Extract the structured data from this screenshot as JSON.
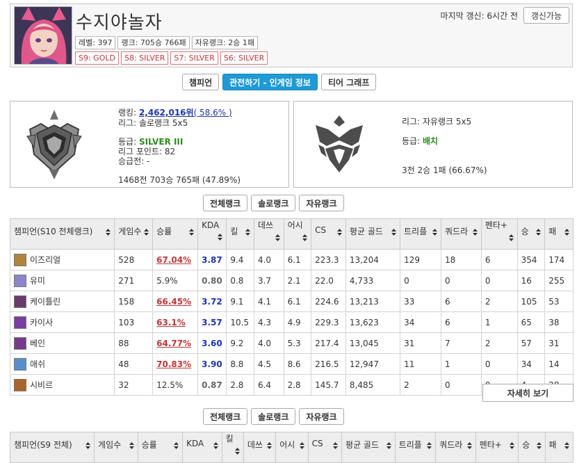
{
  "profile": {
    "summoner_name": "수지야놀자",
    "level": "레벨: 397",
    "ranking": "랭크: 705승 766패",
    "flex_rank": "자유랭크: 2승 1패",
    "seasons": [
      "S9: GOLD",
      "S8: SILVER",
      "S7: SILVER",
      "S6: SILVER"
    ],
    "last_update": "마지막 갱신: 6시간 전",
    "update_button": "갱신가능"
  },
  "main_tabs": [
    {
      "label": "챔피언",
      "active": false
    },
    {
      "label": "관전하기 - 인게임 정보",
      "active": true
    },
    {
      "label": "티어 그래프",
      "active": false
    }
  ],
  "solo_rank": {
    "ranking_label": "랭킹: ",
    "ranking_value": "2,462,016위",
    "ranking_pct": "( 58.6% )",
    "league": "리그: 솔로랭크 5x5",
    "tier_label": "등급: ",
    "tier_value": "SILVER III",
    "lp": "리그 포인트: 82",
    "promo": "승급전: -",
    "record": "1468전 703승 765패 (47.89%)"
  },
  "flex_rank": {
    "league": "리그: 자유랭크 5x5",
    "tier_label": "등급: ",
    "tier_value": "배치",
    "record": "3전 2승 1패 (66.67%)"
  },
  "sub_tabs": [
    "전체랭크",
    "솔로랭크",
    "자유랭크"
  ],
  "s10_table": {
    "headers": [
      "챔피언(S10 전체랭크)",
      "게임수",
      "승률",
      "KDA",
      "킬",
      "데쓰",
      "어시",
      "CS",
      "평균 골드",
      "트리플",
      "쿼드라",
      "펜타+",
      "승",
      "패"
    ],
    "rows": [
      {
        "champion": "이즈리얼",
        "icon_color": "#b0843c",
        "games": "528",
        "winrate": "67.04%",
        "winrate_hi": true,
        "kda": "3.87",
        "kda_hi": true,
        "kills": "9.4",
        "deaths": "4.0",
        "assists": "6.1",
        "cs": "223.3",
        "gold": "13,204",
        "triple": "129",
        "quadra": "18",
        "penta": "6",
        "wins": "354",
        "losses": "174"
      },
      {
        "champion": "유미",
        "icon_color": "#8d86c9",
        "games": "271",
        "winrate": "5.9%",
        "winrate_hi": false,
        "kda": "0.80",
        "kda_hi": false,
        "kills": "0.8",
        "deaths": "3.7",
        "assists": "2.1",
        "cs": "22.0",
        "gold": "4,733",
        "triple": "0",
        "quadra": "0",
        "penta": "0",
        "wins": "16",
        "losses": "255"
      },
      {
        "champion": "케이틀린",
        "icon_color": "#6b3a6a",
        "games": "158",
        "winrate": "66.45%",
        "winrate_hi": true,
        "kda": "3.72",
        "kda_hi": true,
        "kills": "9.1",
        "deaths": "4.1",
        "assists": "6.1",
        "cs": "224.6",
        "gold": "13,213",
        "triple": "33",
        "quadra": "6",
        "penta": "2",
        "wins": "105",
        "losses": "53"
      },
      {
        "champion": "카이사",
        "icon_color": "#7a3fa0",
        "games": "103",
        "winrate": "63.1%",
        "winrate_hi": true,
        "kda": "3.57",
        "kda_hi": true,
        "kills": "10.5",
        "deaths": "4.3",
        "assists": "4.9",
        "cs": "229.3",
        "gold": "13,623",
        "triple": "34",
        "quadra": "6",
        "penta": "1",
        "wins": "65",
        "losses": "38"
      },
      {
        "champion": "베인",
        "icon_color": "#7a3a8c",
        "games": "88",
        "winrate": "64.77%",
        "winrate_hi": true,
        "kda": "3.60",
        "kda_hi": true,
        "kills": "9.2",
        "deaths": "4.0",
        "assists": "5.3",
        "cs": "217.4",
        "gold": "13,045",
        "triple": "31",
        "quadra": "7",
        "penta": "2",
        "wins": "57",
        "losses": "31"
      },
      {
        "champion": "애쉬",
        "icon_color": "#5a8ec9",
        "games": "48",
        "winrate": "70.83%",
        "winrate_hi": true,
        "kda": "3.90",
        "kda_hi": true,
        "kills": "8.8",
        "deaths": "4.5",
        "assists": "8.6",
        "cs": "216.5",
        "gold": "12,947",
        "triple": "11",
        "quadra": "1",
        "penta": "0",
        "wins": "34",
        "losses": "14"
      },
      {
        "champion": "시비르",
        "icon_color": "#a8662a",
        "games": "32",
        "winrate": "12.5%",
        "winrate_hi": false,
        "kda": "0.87",
        "kda_hi": false,
        "kills": "2.8",
        "deaths": "6.4",
        "assists": "2.8",
        "cs": "145.7",
        "gold": "8,485",
        "triple": "2",
        "quadra": "0",
        "penta": "0",
        "wins": "4",
        "losses": "28"
      }
    ]
  },
  "more_button": "자세히 보기",
  "s9_table": {
    "headers": [
      "챔피언(S9 전체)",
      "게임수",
      "승률",
      "KDA",
      "킬",
      "데쓰",
      "어시",
      "CS",
      "평균 골드",
      "트리플",
      "쿼드라",
      "펜타+",
      "승",
      "패"
    ]
  },
  "colors": {
    "active_tab": "#1f9ad6",
    "high_winrate": "#c23636",
    "high_kda": "#1d34b0",
    "tier_green": "#2e8b20"
  }
}
